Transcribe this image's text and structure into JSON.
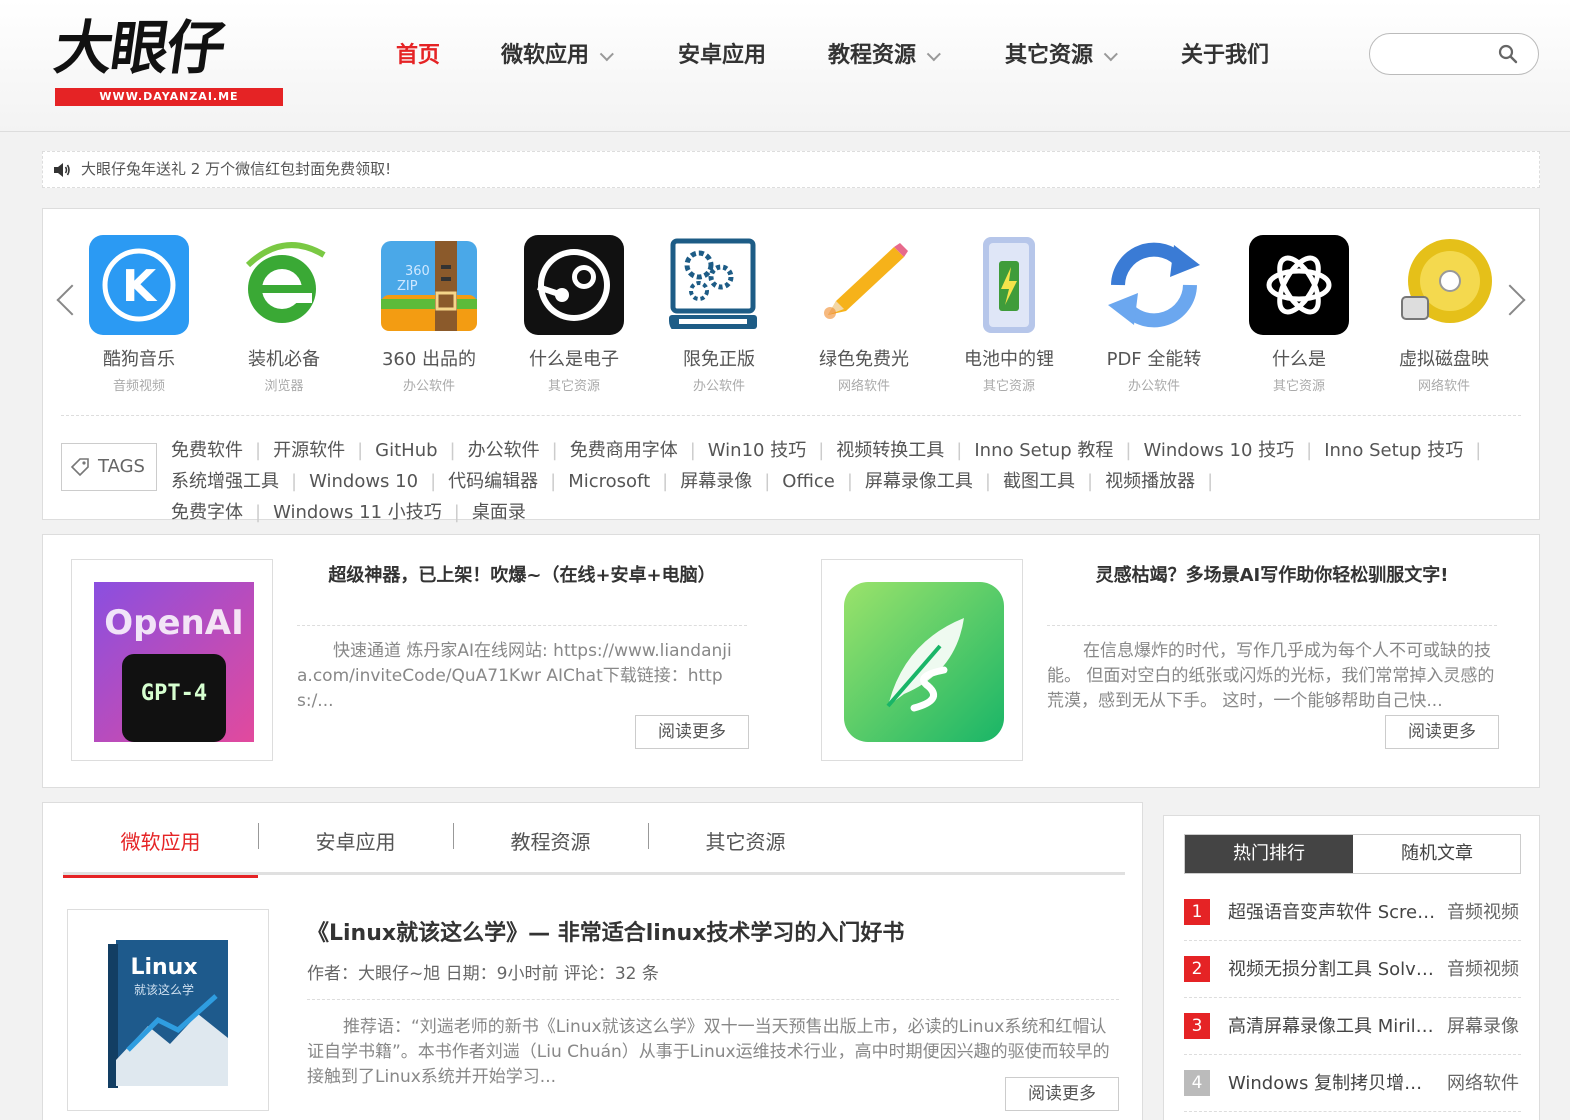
{
  "header": {
    "logo_text": "大眼仔",
    "logo_url": "WWW.DAYANZAI.ME",
    "nav": [
      {
        "label": "首页",
        "active": true,
        "dropdown": false
      },
      {
        "label": "微软应用",
        "active": false,
        "dropdown": true
      },
      {
        "label": "安卓应用",
        "active": false,
        "dropdown": false
      },
      {
        "label": "教程资源",
        "active": false,
        "dropdown": true
      },
      {
        "label": "其它资源",
        "active": false,
        "dropdown": true
      },
      {
        "label": "关于我们",
        "active": false,
        "dropdown": false
      }
    ],
    "search_placeholder": ""
  },
  "notice": {
    "text": "大眼仔兔年送礼 2 万个微信红包封面免费领取!"
  },
  "carousel": {
    "apps": [
      {
        "title": "酷狗音乐",
        "category": "音频视频",
        "icon": "kugou-icon"
      },
      {
        "title": "装机必备",
        "category": "浏览器",
        "icon": "ie-icon"
      },
      {
        "title": "360 出品的",
        "category": "办公软件",
        "icon": "zip-icon"
      },
      {
        "title": "什么是电子",
        "category": "其它资源",
        "icon": "steam-icon"
      },
      {
        "title": "限免正版",
        "category": "办公软件",
        "icon": "monitor-gear-icon"
      },
      {
        "title": "绿色免费光",
        "category": "网络软件",
        "icon": "pencil-icon"
      },
      {
        "title": "电池中的锂",
        "category": "其它资源",
        "icon": "battery-icon"
      },
      {
        "title": "PDF 全能转",
        "category": "办公软件",
        "icon": "sync-icon"
      },
      {
        "title": "什么是",
        "category": "其它资源",
        "icon": "openai-icon"
      },
      {
        "title": "虚拟磁盘映",
        "category": "网络软件",
        "icon": "disc-icon"
      }
    ],
    "tags_label": "TAGS",
    "tags": [
      "免费软件",
      "开源软件",
      "GitHub",
      "办公软件",
      "免费商用字体",
      "Win10 技巧",
      "视频转换工具",
      "Inno Setup 教程",
      "Windows 10 技巧",
      "Inno Setup 技巧",
      "系统增强工具",
      "Windows 10",
      "代码编辑器",
      "Microsoft",
      "屏幕录像",
      "Office",
      "屏幕录像工具",
      "截图工具",
      "视频播放器",
      "免费字体",
      "Windows 11 小技巧",
      "桌面录"
    ]
  },
  "featured": [
    {
      "title": "超级神器，已上架！吹爆~（在线+安卓+电脑）",
      "excerpt": "快速通道 炼丹家AI在线网站: https://www.liandanjia.com/inviteCode/QuA71Kwr AIChat下载链接：https:/...",
      "image_text_top": "OpenAI",
      "image_text_bottom": "GPT-4",
      "more": "阅读更多"
    },
    {
      "title": "灵感枯竭？多场景AI写作助你轻松驯服文字!",
      "excerpt": "在信息爆炸的时代，写作几乎成为每个人不可或缺的技能。 但面对空白的纸张或闪烁的光标，我们常常掉入灵感的荒漠，感到无从下手。 这时，一个能够帮助自己快...",
      "more": "阅读更多"
    }
  ],
  "main": {
    "tabs": [
      "微软应用",
      "安卓应用",
      "教程资源",
      "其它资源"
    ],
    "post": {
      "title": "《Linux就该这么学》— 非常适合linux技术学习的入门好书",
      "meta": "作者：大眼仔~旭 日期：9小时前 评论：32 条",
      "excerpt": "推荐语：“刘遄老师的新书《Linux就该这么学》双十一当天预售出版上市，必读的Linux系统和红帽认证自学书籍”。本书作者刘遄（Liu Chuán）从事于Linux运维技术行业，高中时期便因兴趣的驱使而较早的接触到了Linux系统并开始学习...",
      "book_title": "Linux",
      "book_subtitle": "就该这么学",
      "more": "阅读更多"
    }
  },
  "sidebar": {
    "tabs": [
      "热门排行",
      "随机文章"
    ],
    "ranks": [
      {
        "num": "1",
        "title": "超强语音变声软件 Screa...",
        "category": "音频视频",
        "color": "#e52325"
      },
      {
        "num": "2",
        "title": "视频无损分割工具 Solve...",
        "category": "音频视频",
        "color": "#e52325"
      },
      {
        "num": "3",
        "title": "高清屏幕录像工具 Mirilli...",
        "category": "屏幕录像",
        "color": "#e52325"
      },
      {
        "num": "4",
        "title": "Windows 复制拷贝增强...",
        "category": "网络软件",
        "color": "#bbbbbb"
      }
    ]
  },
  "colors": {
    "accent": "#e52325",
    "dark_tab": "#444444"
  }
}
